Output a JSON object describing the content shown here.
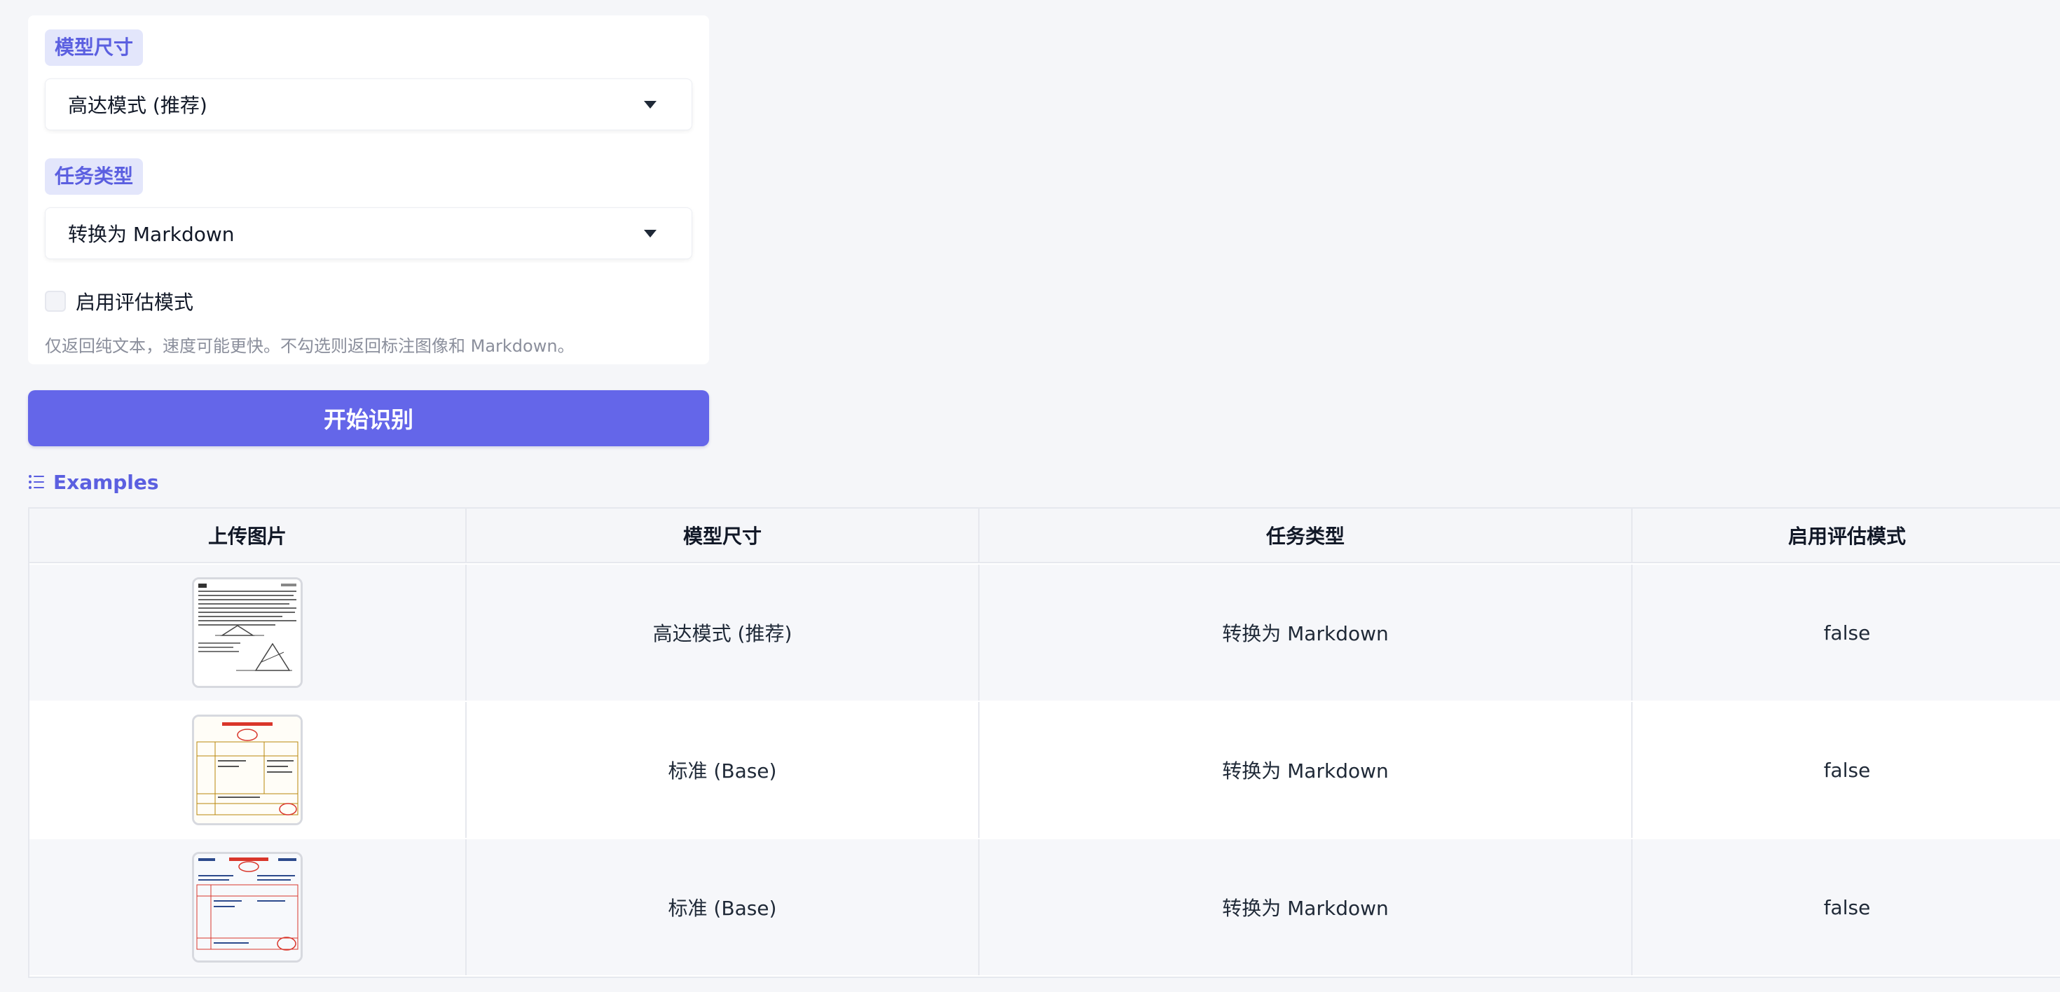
{
  "form": {
    "model_size": {
      "label": "模型尺寸",
      "value": "高达模式 (推荐)"
    },
    "task_type": {
      "label": "任务类型",
      "value": "转换为 Markdown"
    },
    "eval_mode": {
      "label": "启用评估模式",
      "checked": false,
      "hint": "仅返回纯文本，速度可能更快。不勾选则返回标注图像和 Markdown。"
    }
  },
  "actions": {
    "start_label": "开始识别"
  },
  "examples": {
    "title": "Examples",
    "icon": "list-icon",
    "columns": [
      "上传图片",
      "模型尺寸",
      "任务类型",
      "启用评估模式"
    ],
    "rows": [
      {
        "image": "document-thumbnail",
        "model_size": "高达模式 (推荐)",
        "task_type": "转换为 Markdown",
        "eval_mode": "false"
      },
      {
        "image": "invoice-thumbnail",
        "model_size": "标准 (Base)",
        "task_type": "转换为 Markdown",
        "eval_mode": "false"
      },
      {
        "image": "receipt-thumbnail",
        "model_size": "标准 (Base)",
        "task_type": "转换为 Markdown",
        "eval_mode": "false"
      }
    ]
  },
  "colors": {
    "accent": "#6466e9",
    "label_bg": "#e3e6fb",
    "label_text": "#5b5fe0",
    "stamp_red": "#d9362b"
  }
}
